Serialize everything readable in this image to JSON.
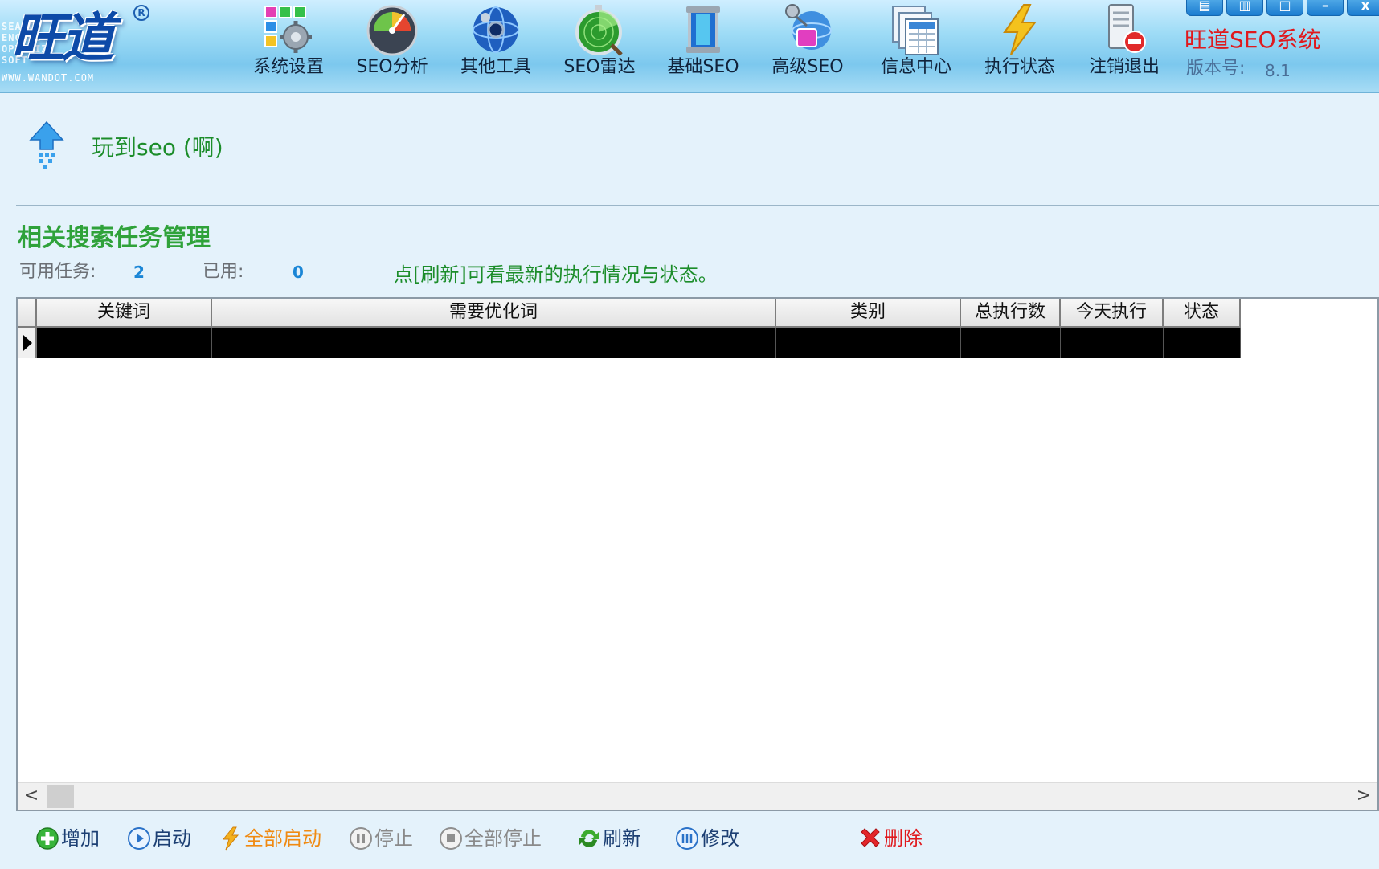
{
  "logo": {
    "text": "旺道",
    "side_text": "SEARCH\nENGINE\nOPTIMIZE\nSOFT",
    "url": "WWW.WANDOT.COM",
    "registered": "R"
  },
  "toolbar": {
    "items": [
      {
        "label": "系统设置",
        "icon": "settings-grid-icon"
      },
      {
        "label": "SEO分析",
        "icon": "gauge-icon"
      },
      {
        "label": "其他工具",
        "icon": "globe-tools-icon"
      },
      {
        "label": "SEO雷达",
        "icon": "radar-icon"
      },
      {
        "label": "基础SEO",
        "icon": "cylinder-icon"
      },
      {
        "label": "高级SEO",
        "icon": "satellite-icon"
      },
      {
        "label": "信息中心",
        "icon": "documents-icon"
      },
      {
        "label": "执行状态",
        "icon": "lightning-icon"
      },
      {
        "label": "注销退出",
        "icon": "logout-server-icon"
      }
    ]
  },
  "app": {
    "title": "旺道SEO系统",
    "version_label": "版本号:",
    "version": "8.1"
  },
  "window_controls": {
    "minimize": "–",
    "close": "x"
  },
  "page": {
    "site_title": "玩到seo (啊)"
  },
  "section": {
    "title": "相关搜索任务管理",
    "available_label": "可用任务:",
    "available_value": "2",
    "used_label": "已用:",
    "used_value": "0",
    "hint": "点[刷新]可看最新的执行情况与状态。"
  },
  "grid": {
    "columns": [
      "关键词",
      "需要优化词",
      "类别",
      "总执行数",
      "今天执行",
      "状态"
    ],
    "rows": [
      {
        "keyword": "",
        "optimize_words": "",
        "category": "",
        "total": "",
        "today": "",
        "status": ""
      }
    ],
    "scroll_left": "<",
    "scroll_right": ">"
  },
  "actions": {
    "add": "增加",
    "start": "启动",
    "start_all": "全部启动",
    "stop": "停止",
    "stop_all": "全部停止",
    "refresh": "刷新",
    "edit": "修改",
    "delete": "删除"
  },
  "colors": {
    "accent_green": "#1c8d2a",
    "title_red": "#e0191d",
    "value_blue": "#1a86d6",
    "start_all_orange": "#f08a12",
    "delete_red": "#e0191d"
  }
}
